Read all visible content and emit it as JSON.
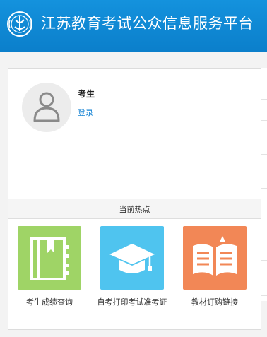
{
  "header": {
    "title": "江苏教育考试公众信息服务平台",
    "logo_icon": "jiangsu-exam-logo"
  },
  "user": {
    "name": "考生",
    "login_label": "登录",
    "avatar_icon": "user-avatar-icon"
  },
  "section": {
    "title": "当前热点"
  },
  "tiles": [
    {
      "label": "考生成绩查询",
      "color": "#9fd466",
      "icon": "notebook-icon"
    },
    {
      "label": "自考打印考试准考证",
      "color": "#4fc4ef",
      "icon": "graduation-cap-icon"
    },
    {
      "label": "教材订购链接",
      "color": "#f28756",
      "icon": "open-book-icon"
    }
  ]
}
